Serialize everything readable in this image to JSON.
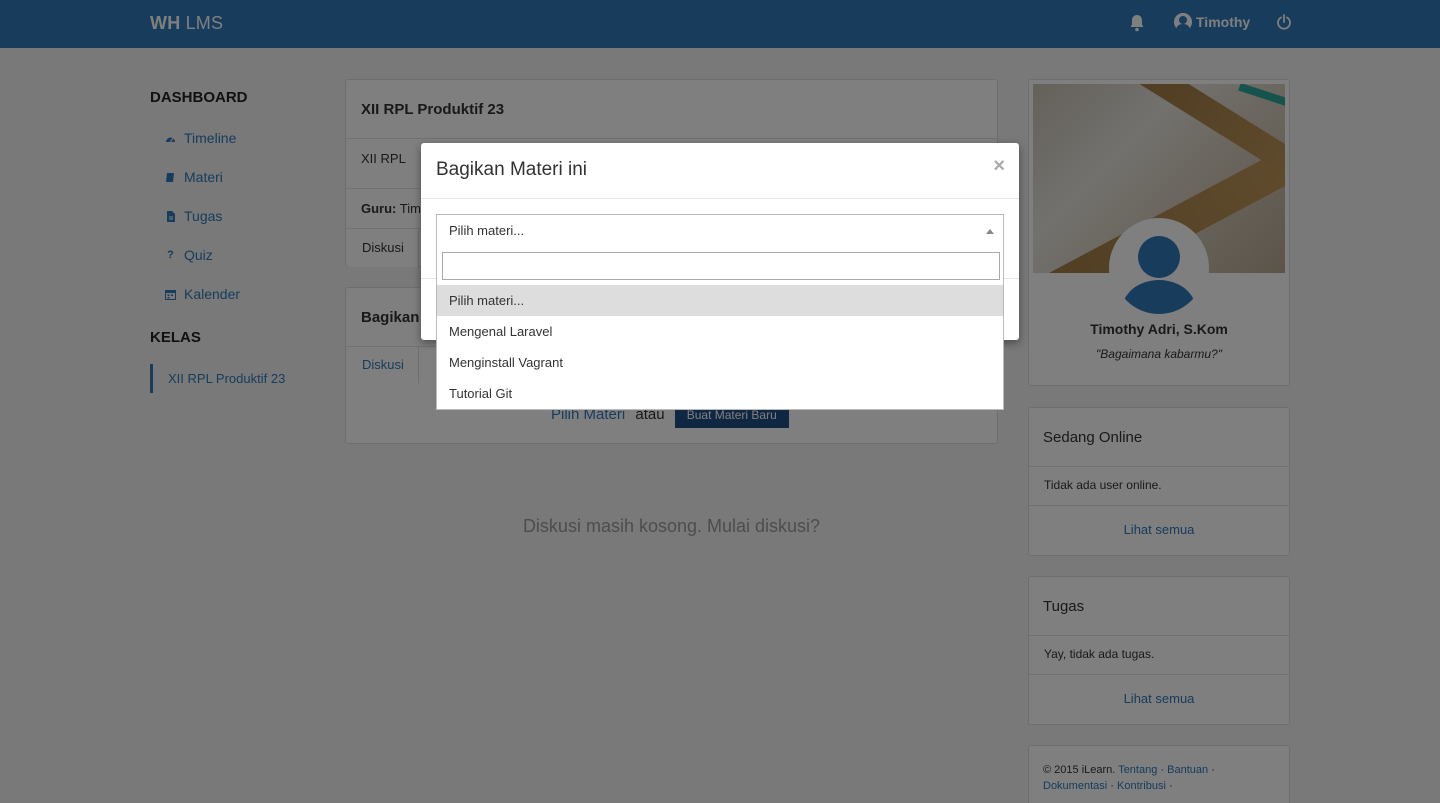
{
  "navbar": {
    "brand_bold": "WH",
    "brand_rest": " LMS",
    "user_name": "Timothy"
  },
  "sidebar": {
    "dashboard_heading": "DASHBOARD",
    "items": [
      {
        "label": "Timeline",
        "icon": "dashboard-icon"
      },
      {
        "label": "Materi",
        "icon": "book-icon"
      },
      {
        "label": "Tugas",
        "icon": "file-icon"
      },
      {
        "label": "Quiz",
        "icon": "question-icon"
      },
      {
        "label": "Kalender",
        "icon": "calendar-icon"
      }
    ],
    "kelas_heading": "KELAS",
    "kelas_items": [
      {
        "label": "XII RPL Produktif 23"
      }
    ]
  },
  "main": {
    "class_title": "XII RPL Produktif 23",
    "class_desc": "XII RPL",
    "guru_label": "Guru:",
    "guru_value": "Timothy Adri, S.Kom",
    "tab_diskusi": "Diskusi",
    "share_title": "Bagikan Materi",
    "share_tab": "Diskusi",
    "pick_link": "Pilih Materi",
    "or_text": "atau",
    "new_button": "Buat Materi Baru",
    "empty_message": "Diskusi masih kosong. Mulai diskusi?"
  },
  "profile": {
    "name": "Timothy Adri, S.Kom",
    "quote": "\"Bagaimana kabarmu?\""
  },
  "online_panel": {
    "title": "Sedang Online",
    "body": "Tidak ada user online.",
    "link": "Lihat semua"
  },
  "tugas_panel": {
    "title": "Tugas",
    "body": "Yay, tidak ada tugas.",
    "link": "Lihat semua"
  },
  "footer": {
    "copyright": "© 2015 iLearn.",
    "links": [
      "Tentang",
      "Bantuan",
      "Dokumentasi",
      "Kontribusi"
    ],
    "separator": "·"
  },
  "modal": {
    "title": "Bagikan Materi ini",
    "close": "×",
    "select_value": "Pilih materi...",
    "search_placeholder": "",
    "options": [
      "Pilih materi...",
      "Mengenal Laravel",
      "Menginstall Vagrant",
      "Tutorial Git"
    ],
    "highlighted_index": 0
  },
  "colors": {
    "primary": "#2e78b8",
    "navbar": "#2e78b8",
    "dark_button": "#1f4f86"
  }
}
